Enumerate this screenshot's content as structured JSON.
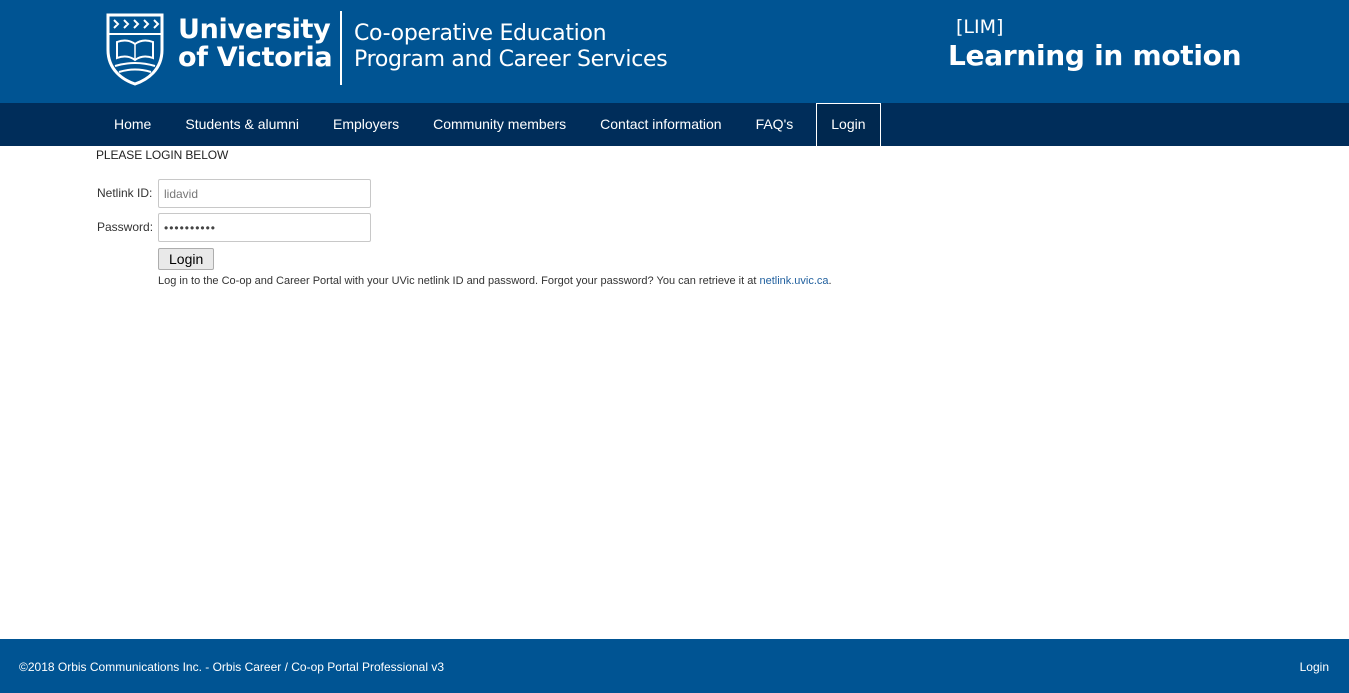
{
  "header": {
    "university_line1": "University",
    "university_line2": "of Victoria",
    "dept_line1": "Co-operative Education",
    "dept_line2": "Program and Career Services",
    "brand_tag": "[LIM]",
    "brand_title": "Learning in motion",
    "banner_color": "#005493"
  },
  "nav": {
    "items": [
      {
        "label": "Home"
      },
      {
        "label": "Students & alumni"
      },
      {
        "label": "Employers"
      },
      {
        "label": "Community members"
      },
      {
        "label": "Contact information"
      },
      {
        "label": "FAQ's"
      },
      {
        "label": "Login",
        "active": true
      }
    ],
    "bar_color": "#002d5a"
  },
  "login": {
    "heading": "PLEASE LOGIN BELOW",
    "netlink_label": "Netlink ID:",
    "netlink_value": "lidavid",
    "password_label": "Password:",
    "password_value": "••••••••••",
    "button_label": "Login",
    "help_text": "Log in to the Co-op and Career Portal with your UVic netlink ID and password. Forgot your password? You can retrieve it at ",
    "help_link": "netlink.uvic.ca",
    "help_suffix": "."
  },
  "footer": {
    "copyright": "©2018 Orbis Communications Inc. - Orbis Career / Co-op Portal Professional v3",
    "login_link": "Login"
  }
}
